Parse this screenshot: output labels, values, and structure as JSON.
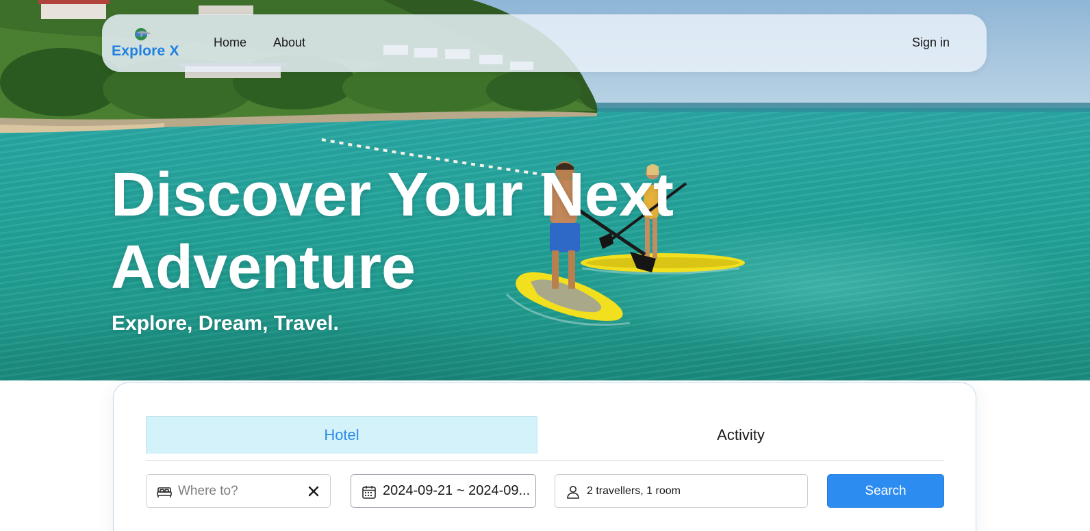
{
  "colors": {
    "brand": "#1f7fe3",
    "active_tab_bg": "#d3f2fa",
    "active_tab_text": "#2e8be6",
    "primary_button": "#2d8cf0"
  },
  "navbar": {
    "logo_text": "Explore X",
    "logo_icon": "globe-airplane-icon",
    "links": [
      {
        "label": "Home"
      },
      {
        "label": "About"
      }
    ],
    "signin_label": "Sign in"
  },
  "hero": {
    "title_line1": "Discover Your Next",
    "title_line2": "Adventure",
    "subtitle": "Explore, Dream, Travel."
  },
  "search": {
    "tabs": [
      {
        "label": "Hotel",
        "active": true
      },
      {
        "label": "Activity",
        "active": false
      }
    ],
    "where": {
      "placeholder": "Where to?",
      "value": "",
      "icon": "bed-icon",
      "clear_icon": "close-icon"
    },
    "dates": {
      "value": "2024-09-21 ~ 2024-09...",
      "icon": "calendar-icon"
    },
    "guests": {
      "value": "2 travellers, 1 room",
      "icon": "person-icon"
    },
    "submit_label": "Search"
  }
}
